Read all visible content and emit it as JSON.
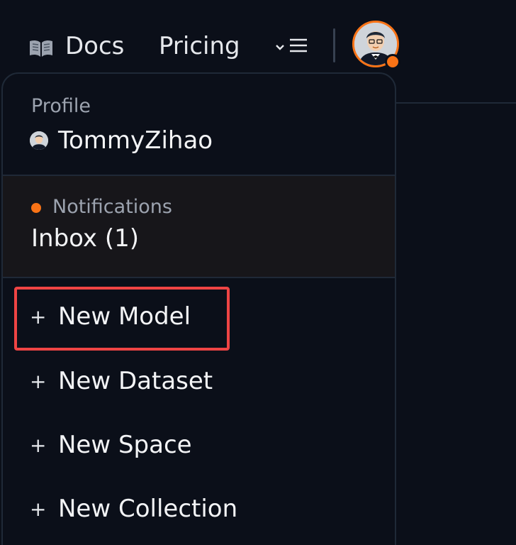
{
  "nav": {
    "docs_label": "Docs",
    "pricing_label": "Pricing",
    "icons": {
      "docs": "book-icon",
      "more": "chevron-down-menu-icon"
    }
  },
  "user": {
    "avatar_icon": "user-avatar",
    "status_color": "#f97316"
  },
  "dropdown": {
    "profile": {
      "label": "Profile",
      "username": "TommyZihao"
    },
    "notifications": {
      "label": "Notifications",
      "inbox": "Inbox (1)"
    },
    "items": [
      {
        "icon": "plus-icon",
        "plus": "+",
        "label": "New Model"
      },
      {
        "icon": "plus-icon",
        "plus": "+",
        "label": "New Dataset"
      },
      {
        "icon": "plus-icon",
        "plus": "+",
        "label": "New Space"
      },
      {
        "icon": "plus-icon",
        "plus": "+",
        "label": "New Collection"
      }
    ]
  },
  "colors": {
    "background": "#0b0f19",
    "accent": "#f97316",
    "highlight_box": "#ef4444"
  }
}
